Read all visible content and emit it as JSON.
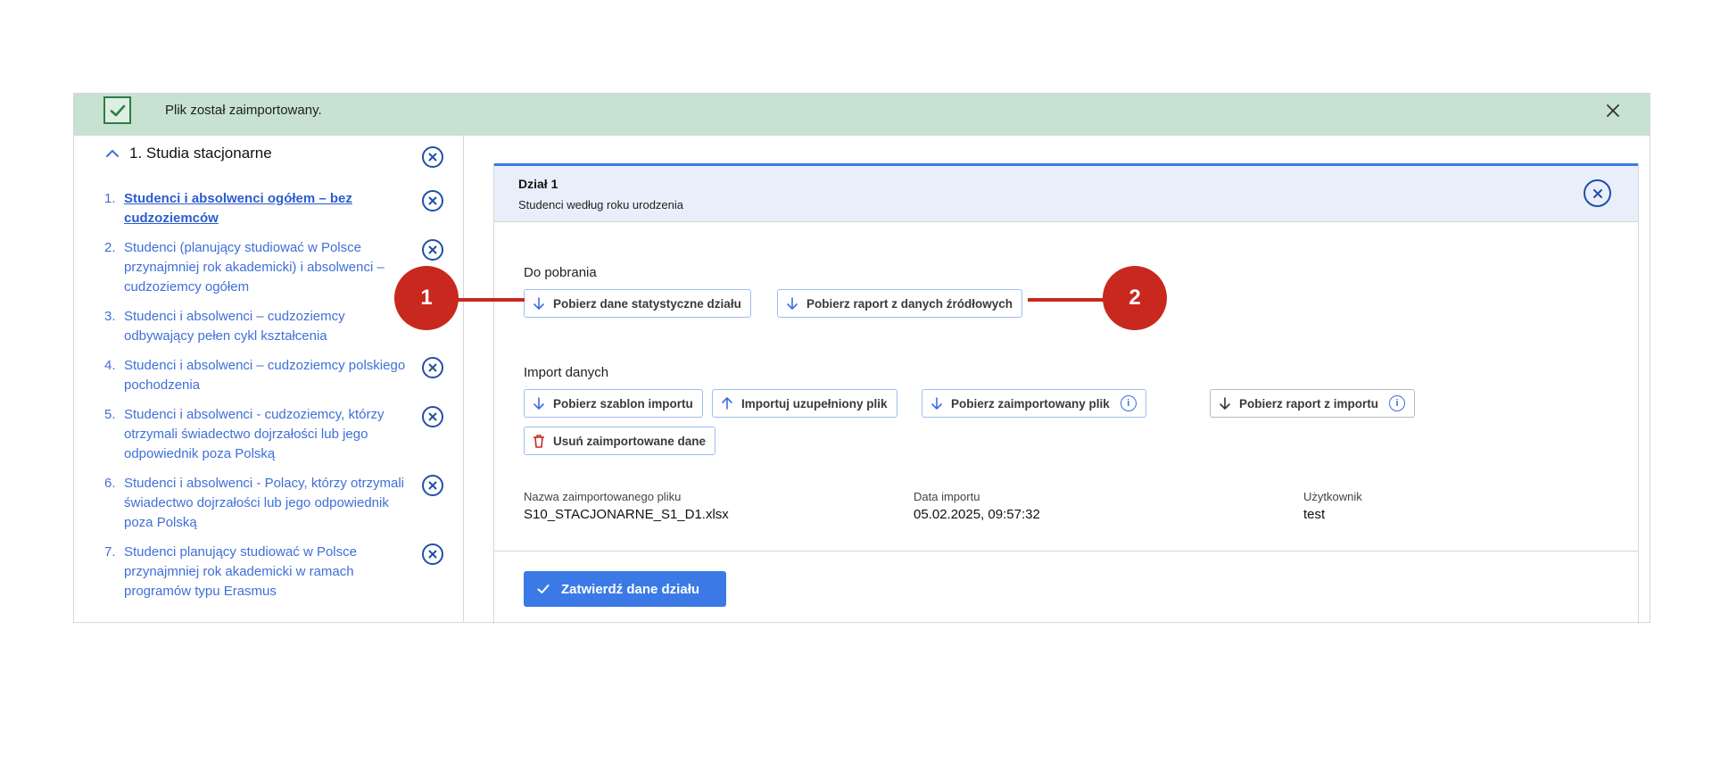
{
  "banner": {
    "message": "Plik został zaimportowany.",
    "colors": {
      "background": "#c7e2d0",
      "icon": "#2e7d46"
    }
  },
  "sidebar": {
    "section_title": "1. Studia stacjonarne",
    "items": [
      {
        "num": "1.",
        "label": "Studenci i absolwenci ogółem – bez cudzoziemców",
        "active": true
      },
      {
        "num": "2.",
        "label": "Studenci (planujący studiować w Polsce przynajmniej rok akademicki) i absolwenci – cudzoziemcy ogółem"
      },
      {
        "num": "3.",
        "label": "Studenci i absolwenci – cudzoziemcy odbywający pełen cykl kształcenia"
      },
      {
        "num": "4.",
        "label": "Studenci i absolwenci – cudzoziemcy polskiego pochodzenia"
      },
      {
        "num": "5.",
        "label": "Studenci i absolwenci - cudzoziemcy, którzy otrzymali świadectwo dojrzałości lub jego odpowiednik poza Polską"
      },
      {
        "num": "6.",
        "label": "Studenci i absolwenci - Polacy, którzy otrzymali świadectwo dojrzałości lub jego odpowiednik poza Polską"
      },
      {
        "num": "7.",
        "label": "Studenci planujący studiować w Polsce przynajmniej rok akademicki w ramach programów typu Erasmus"
      }
    ]
  },
  "panel": {
    "title": "Dział 1",
    "subtitle": "Studenci według roku urodzenia",
    "download_heading": "Do pobrania",
    "download_buttons": {
      "stats": "Pobierz dane statystyczne działu",
      "source_report": "Pobierz raport z danych źródłowych"
    },
    "import_heading": "Import danych",
    "import_buttons": {
      "template": "Pobierz szablon importu",
      "upload": "Importuj uzupełniony plik",
      "imported_file": "Pobierz zaimportowany plik",
      "import_report": "Pobierz raport z importu",
      "delete": "Usuń zaimportowane dane"
    },
    "meta": {
      "file_label": "Nazwa zaimportowanego pliku",
      "file_value": "S10_STACJONARNE_S1_D1.xlsx",
      "date_label": "Data importu",
      "date_value": "05.02.2025, 09:57:32",
      "user_label": "Użytkownik",
      "user_value": "test"
    },
    "confirm_label": "Zatwierdź dane działu",
    "info_glyph": "i",
    "colors": {
      "accent": "#3b7ae6",
      "header_bg": "#e8effb",
      "link": "#3f6fd8",
      "delete": "#c8281e"
    }
  },
  "callouts": {
    "one": "1",
    "two": "2",
    "color": "#c8281e"
  }
}
